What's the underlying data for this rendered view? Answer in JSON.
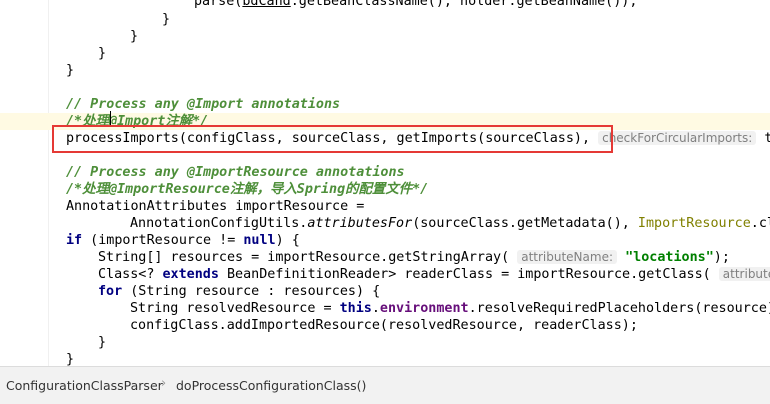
{
  "code": {
    "l0": "parse(",
    "l0b": "bdCand",
    "l0c": ".getBeanClassName(), holder.getBeanName());",
    "l1": "}",
    "l2": "}",
    "l3": "}",
    "l4": "}",
    "l6": "// Process any @Import annotations",
    "l7": "/*处理@Import注解*/",
    "l8a": "processImports(configClass, sourceClass, getImports(sourceClass), ",
    "l8hint": "checkForCircularImports:",
    "l8b": " t",
    "l10": "// Process any @ImportResource annotations",
    "l11": "/*处理@ImportResource注解，导入Spring的配置文件*/",
    "l12": "AnnotationAttributes importResource =",
    "l13a": "AnnotationConfigUtils.",
    "l13b": "attributesFor",
    "l13c": "(sourceClass.getMetadata(), ",
    "l13d": "ImportResource",
    "l13e": ".cl",
    "l14a": "if",
    "l14b": " (importResource != ",
    "l14c": "null",
    "l14d": ") {",
    "l15a": "String[] resources = importResource.getStringArray( ",
    "l15hint": "attributeName:",
    "l15b": " ",
    "l15str": "\"locations\"",
    "l15c": ");",
    "l16a": "Class<? ",
    "l16kw": "extends",
    "l16b": " BeanDefinitionReader> readerClass = importResource.getClass( ",
    "l16hint": "attributeN",
    "l17a": "for",
    "l17b": " (String resource : resources) {",
    "l18a": "String resolvedResource = ",
    "l18kw": "this",
    "l18b": ".",
    "l18fld": "environment",
    "l18c": ".resolveRequiredPlaceholders(resource)",
    "l19": "configClass.addImportedResource(resolvedResource, readerClass);",
    "l20": "}",
    "l21": "}"
  },
  "breadcrumb": {
    "class_name": "ConfigurationClassParser",
    "separator": "›",
    "method_name": "doProcessConfigurationClass()"
  }
}
